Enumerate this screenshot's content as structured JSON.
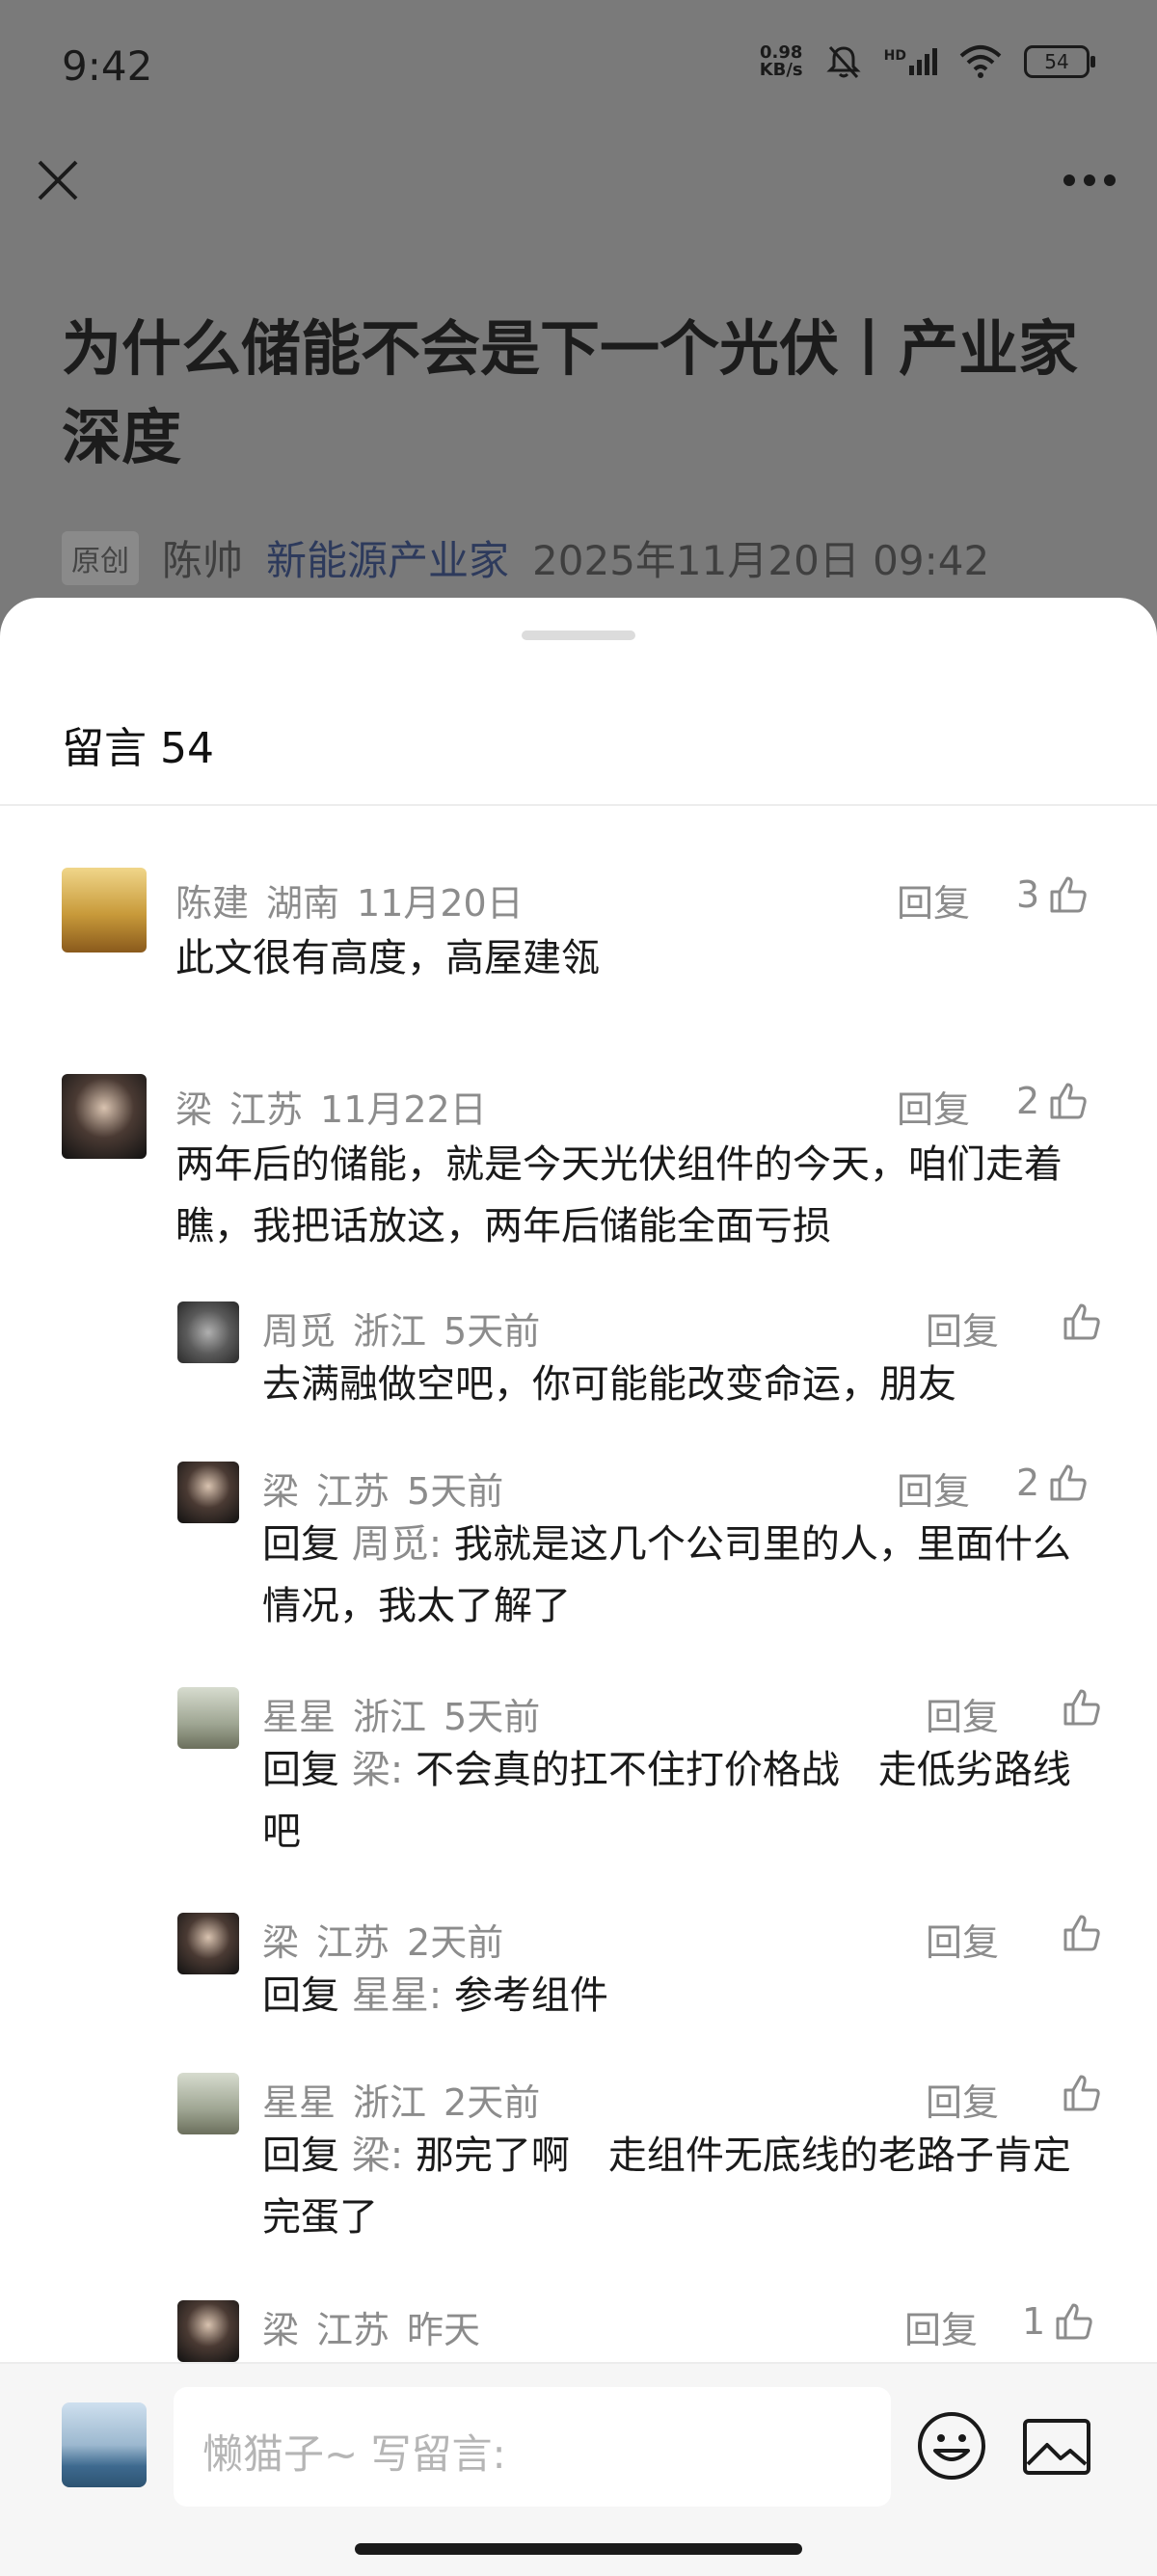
{
  "status_bar": {
    "time": "9:42",
    "speed_value": "0.98",
    "speed_unit": "KB/s",
    "network": "HD",
    "battery": "54"
  },
  "article": {
    "title": "为什么储能不会是下一个光伏丨产业家深度",
    "original_tag": "原创",
    "author": "陈帅",
    "account": "新能源产业家",
    "datetime": "2025年11月20日 09:42"
  },
  "comments_sheet": {
    "title": "留言 54",
    "reply_label": "回复",
    "comments": [
      {
        "name": "陈建",
        "location": "湖南",
        "time": "11月20日",
        "text": "此文很有高度，高屋建瓴",
        "likes": "3"
      },
      {
        "name": "梁",
        "location": "江苏",
        "time": "11月22日",
        "text": "两年后的储能，就是今天光伏组件的今天，咱们走着瞧，我把话放这，两年后储能全面亏损",
        "likes": "2"
      },
      {
        "name": "周觅",
        "location": "浙江",
        "time": "5天前",
        "text": "去满融做空吧，你可能能改变命运，朋友",
        "likes": ""
      },
      {
        "name": "梁",
        "location": "江苏",
        "time": "5天前",
        "reply_to": "周觅",
        "text": "我就是这几个公司里的人，里面什么情况，我太了解了",
        "likes": "2"
      },
      {
        "name": "星星",
        "location": "浙江",
        "time": "5天前",
        "reply_to": "梁",
        "text": "不会真的扛不住打价格战　走低劣路线吧",
        "likes": ""
      },
      {
        "name": "梁",
        "location": "江苏",
        "time": "2天前",
        "reply_to": "星星",
        "text": "参考组件",
        "likes": ""
      },
      {
        "name": "星星",
        "location": "浙江",
        "time": "2天前",
        "reply_to": "梁",
        "text": "那完了啊　走组件无底线的老路子肯定完蛋了",
        "likes": ""
      },
      {
        "name": "梁",
        "location": "江苏",
        "time": "昨天",
        "likes": "1"
      }
    ],
    "reply_prefix": "回复"
  },
  "footer": {
    "input_placeholder": "懒猫子~ 写留言:"
  },
  "colors": {
    "accent_link": "#2d3a5c",
    "muted_text": "#8c8c8c",
    "overlay": "#7a7a7a"
  },
  "icons": [
    "close-icon",
    "more-icon",
    "thumbs-up-icon",
    "emoji-icon",
    "image-icon",
    "wifi-icon",
    "signal-icon",
    "mute-icon"
  ]
}
